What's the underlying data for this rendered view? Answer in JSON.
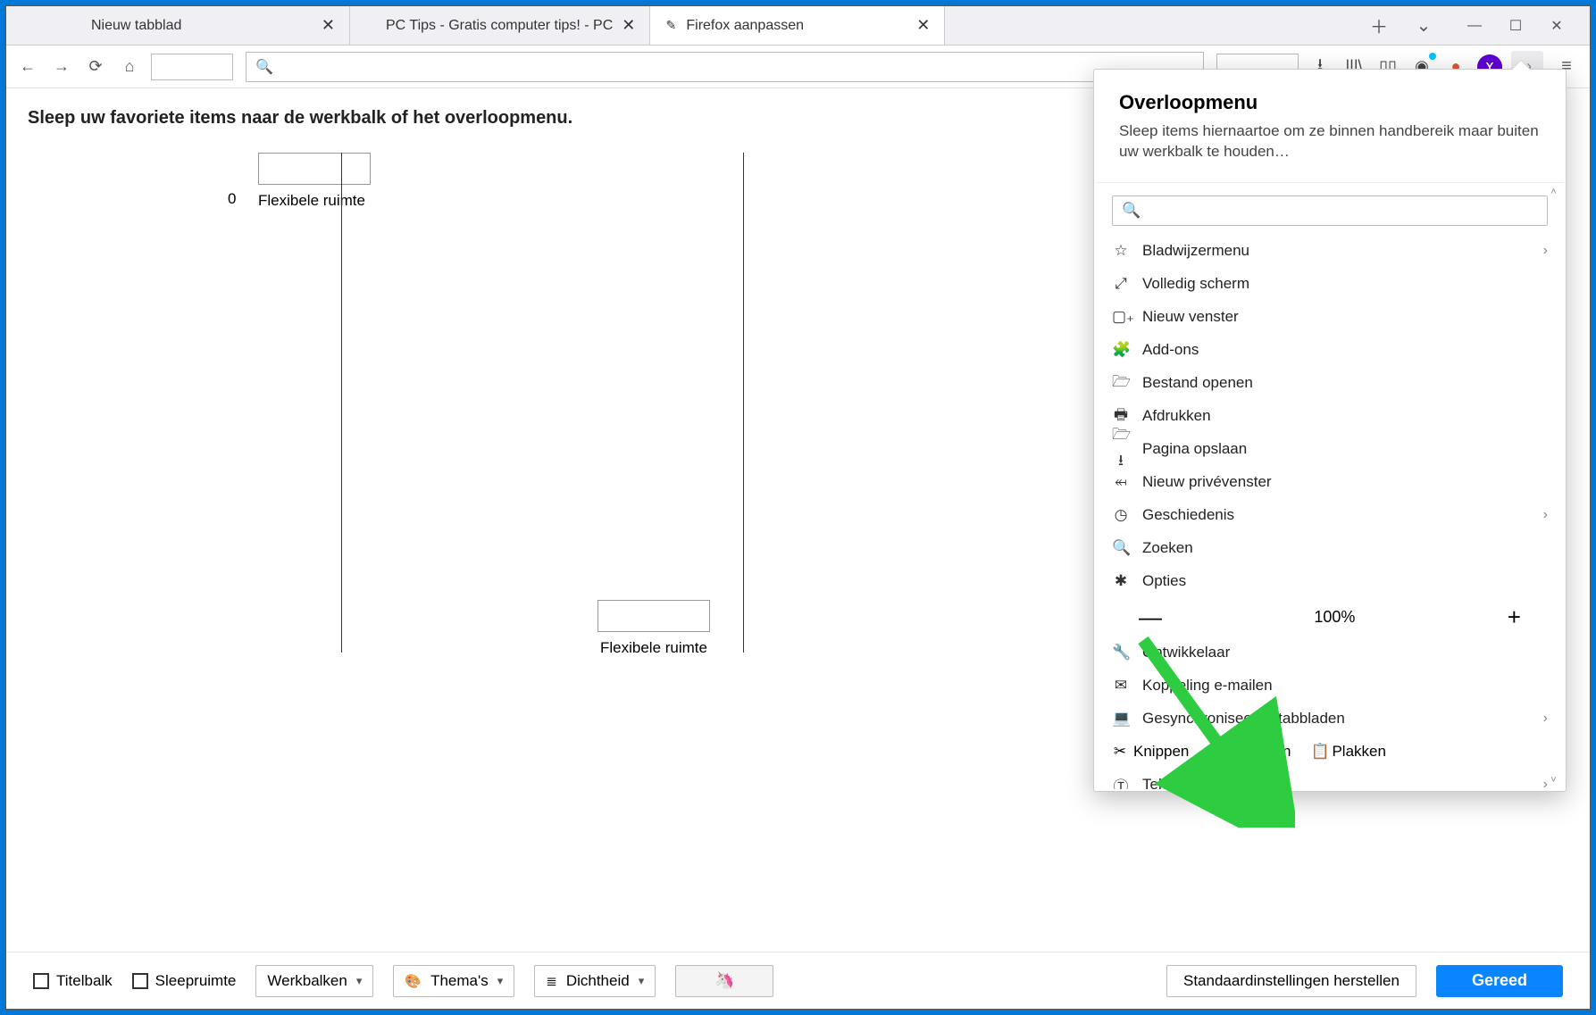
{
  "tabs": {
    "items": [
      {
        "title": "Nieuw tabblad",
        "active": false,
        "icon": ""
      },
      {
        "title": "PC Tips - Gratis computer tips! - PC",
        "active": false,
        "icon": ""
      },
      {
        "title": "Firefox aanpassen",
        "active": true,
        "icon": "✎"
      }
    ],
    "new_tab_tooltip": "Nieuw tabblad"
  },
  "window_controls": {
    "min": "—",
    "max": "☐",
    "close": "✕"
  },
  "toolbar": {
    "nav": {
      "back": "←",
      "forward": "→",
      "reload": "⟳",
      "home": "⌂"
    },
    "right_icons": {
      "downloads": "⭳",
      "library": "|||\\",
      "reader": "▯▯",
      "profile": "◉",
      "duck": "●",
      "yahoo": "Y",
      "overflow": "»",
      "menu": "≡"
    }
  },
  "customize": {
    "heading": "Sleep uw favoriete items naar de werkbalk of het overloopmenu.",
    "items": [
      {
        "index": "0",
        "label": "Flexibele ruimte"
      },
      {
        "label": "Flexibele ruimte"
      }
    ]
  },
  "overflow_panel": {
    "title": "Overloopmenu",
    "description": "Sleep items hiernaartoe om ze binnen handbereik maar buiten uw werkbalk te houden…",
    "search_icon": "🔍",
    "zoom": {
      "value": "100%",
      "minus": "—",
      "plus": "+"
    },
    "edit_row": {
      "cut": "Knippen",
      "copy": "Kopiëren",
      "paste": "Plakken"
    },
    "items": [
      {
        "icon": "☆",
        "label": "Bladwijzermenu",
        "chev": true
      },
      {
        "icon": "⤢",
        "label": "Volledig scherm"
      },
      {
        "icon": "▢₊",
        "label": "Nieuw venster"
      },
      {
        "icon": "🧩",
        "label": "Add-ons"
      },
      {
        "icon": "🗁",
        "label": "Bestand openen"
      },
      {
        "icon": "🖶",
        "label": "Afdrukken"
      },
      {
        "icon": "🗁⭳",
        "label": "Pagina opslaan"
      },
      {
        "icon": "⬶",
        "label": "Nieuw privévenster"
      },
      {
        "icon": "◷",
        "label": "Geschiedenis",
        "chev": true
      },
      {
        "icon": "🔍",
        "label": "Zoeken"
      },
      {
        "icon": "✱",
        "label": "Opties"
      }
    ],
    "items2": [
      {
        "icon": "🔧",
        "label": "Ontwikkelaar"
      },
      {
        "icon": "✉",
        "label": "Koppeling e-mailen"
      },
      {
        "icon": "💻",
        "label": "Gesynchroniseerde tabbladen",
        "chev": true
      }
    ],
    "last": {
      "icon": "Ⓣ",
      "label": "Tekstcodering",
      "chev": true
    }
  },
  "footer": {
    "titlebar": "Titelbalk",
    "dragspace": "Sleepruimte",
    "toolbars": "Werkbalken",
    "themes": "Thema's",
    "density": "Dichtheid",
    "restore": "Standaardinstellingen herstellen",
    "done": "Gereed"
  }
}
